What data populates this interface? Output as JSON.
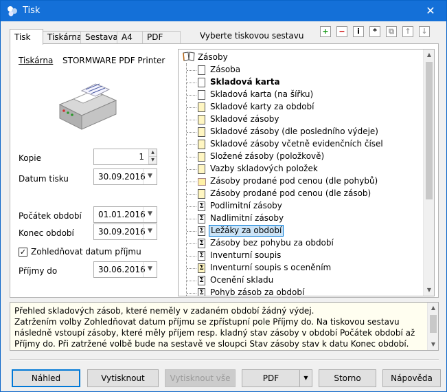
{
  "window": {
    "title": "Tisk",
    "close_glyph": "✕"
  },
  "tabs": [
    "Tisk",
    "Tiskárna",
    "Sestava",
    "A4",
    "PDF"
  ],
  "tree_header": "Vyberte tiskovou sestavu",
  "printer": {
    "label": "Tiskárna",
    "name": "STORMWARE PDF Printer"
  },
  "fields": {
    "kopie": {
      "label": "Kopie",
      "value": "1"
    },
    "datum_tisku": {
      "label": "Datum tisku",
      "value": "30.09.2016"
    },
    "pocatek": {
      "label": "Počátek období",
      "value": "01.01.2016"
    },
    "konec": {
      "label": "Konec období",
      "value": "30.09.2016"
    },
    "zohlednovat": {
      "label": "Zohledňovat datum příjmu",
      "checked": true
    },
    "prijmy_do": {
      "label": "Příjmy do",
      "value": "30.06.2016"
    }
  },
  "tree": {
    "root": "Zásoby",
    "items": [
      {
        "label": "Zásoba",
        "icon": "page",
        "bold": false
      },
      {
        "label": "Skladová karta",
        "icon": "page",
        "bold": true
      },
      {
        "label": "Skladová karta (na šířku)",
        "icon": "page",
        "bold": false
      },
      {
        "label": "Skladové karty za období",
        "icon": "page-yellow",
        "bold": false
      },
      {
        "label": "Skladové zásoby",
        "icon": "page-yellow",
        "bold": false
      },
      {
        "label": "Skladové zásoby (dle posledního výdeje)",
        "icon": "page-yellow",
        "bold": false
      },
      {
        "label": "Skladové zásoby včetně evidenčních čísel",
        "icon": "page-yellow",
        "bold": false
      },
      {
        "label": "Složené zásoby (položkově)",
        "icon": "page-yellow",
        "bold": false
      },
      {
        "label": "Vazby skladových položek",
        "icon": "page-yellow",
        "bold": false
      },
      {
        "label": "Zásoby prodané pod cenou (dle pohybů)",
        "icon": "folder",
        "bold": false
      },
      {
        "label": "Zásoby prodané pod cenou (dle zásob)",
        "icon": "page-yellow",
        "bold": false
      },
      {
        "label": "Podlimitní zásoby",
        "icon": "sigma",
        "bold": false
      },
      {
        "label": "Nadlimitní zásoby",
        "icon": "sigma",
        "bold": false
      },
      {
        "label": "Ležáky za období",
        "icon": "sigma",
        "bold": false,
        "selected": true
      },
      {
        "label": "Zásoby bez pohybu za období",
        "icon": "sigma",
        "bold": false
      },
      {
        "label": "Inventurní soupis",
        "icon": "sigma",
        "bold": false
      },
      {
        "label": "Inventurní soupis s oceněním",
        "icon": "sigma-yellow",
        "bold": false
      },
      {
        "label": "Ocenění skladu",
        "icon": "sigma",
        "bold": false
      },
      {
        "label": "Pohyb zásob za období",
        "icon": "sigma",
        "bold": false
      }
    ]
  },
  "toolbar": [
    {
      "name": "add-report-icon",
      "glyph": "+",
      "color": "#1a9a1a"
    },
    {
      "name": "remove-report-icon",
      "glyph": "−",
      "color": "#d01818"
    },
    {
      "name": "info-icon",
      "glyph": "i",
      "color": "#000000"
    },
    {
      "name": "asterisk-icon",
      "glyph": "*",
      "color": "#000000"
    },
    {
      "name": "copy-icon",
      "glyph": "⧉",
      "color": "#a0a0a0"
    },
    {
      "name": "move-up-icon",
      "glyph": "↑",
      "color": "#a0a0a0"
    },
    {
      "name": "move-down-icon",
      "glyph": "↓",
      "color": "#a0a0a0"
    }
  ],
  "description": {
    "line1": "Přehled skladových zásob, které neměly v zadaném období žádný výdej.",
    "line2": "Zatržením volby Zohledňovat datum příjmu se zpřístupní pole Příjmy do. Na tiskovou sestavu následně vstoupí zásoby, které měly příjem resp. kladný stav zásoby v období Počátek období až Příjmy do. Při zatržené volbě bude na sestavě ve sloupci Stav zásoby stav k datu Konec období."
  },
  "buttons": {
    "nahled": "Náhled",
    "vytisknout": "Vytisknout",
    "vytisknout_vse": "Vytisknout vše",
    "pdf": "PDF",
    "storno": "Storno",
    "napoveda": "Nápověda"
  }
}
